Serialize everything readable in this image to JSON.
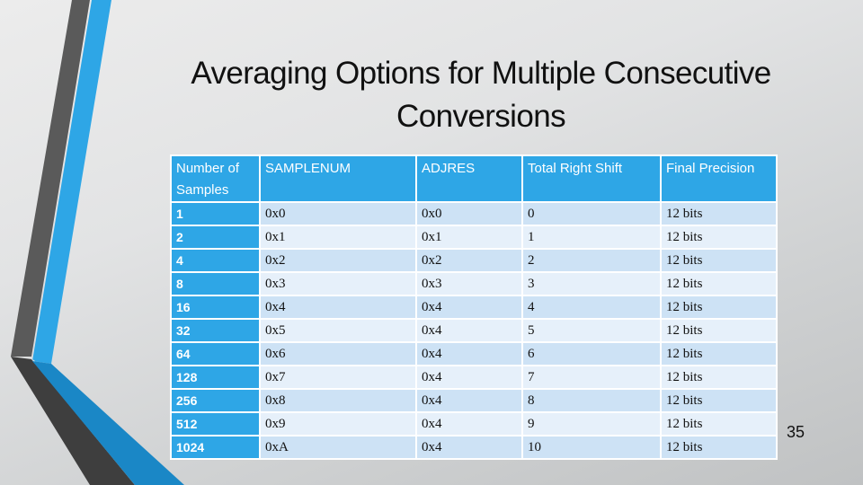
{
  "slide": {
    "title": "Averaging Options for Multiple Consecutive Conversions",
    "page_number": "35",
    "colors": {
      "accent_blue": "#2ea6e6",
      "dark_blue": "#1a87c6",
      "stripe_gray": "#5a5a5a",
      "stripe_dark": "#404040",
      "row_odd": "#cde2f5",
      "row_even": "#e6f0fa"
    }
  },
  "table": {
    "headers": [
      "Number of Samples",
      "SAMPLENUM",
      "ADJRES",
      "Total Right Shift",
      "Final Precision"
    ],
    "rows": [
      [
        "1",
        "0x0",
        "0x0",
        "0",
        "12 bits"
      ],
      [
        "2",
        "0x1",
        "0x1",
        "1",
        "12 bits"
      ],
      [
        "4",
        "0x2",
        "0x2",
        "2",
        "12 bits"
      ],
      [
        "8",
        "0x3",
        "0x3",
        "3",
        "12 bits"
      ],
      [
        "16",
        "0x4",
        "0x4",
        "4",
        "12 bits"
      ],
      [
        "32",
        "0x5",
        "0x4",
        "5",
        "12 bits"
      ],
      [
        "64",
        "0x6",
        "0x4",
        "6",
        "12 bits"
      ],
      [
        "128",
        "0x7",
        "0x4",
        "7",
        "12 bits"
      ],
      [
        "256",
        "0x8",
        "0x4",
        "8",
        "12 bits"
      ],
      [
        "512",
        "0x9",
        "0x4",
        "9",
        "12 bits"
      ],
      [
        "1024",
        "0xA",
        "0x4",
        "10",
        "12 bits"
      ]
    ]
  }
}
